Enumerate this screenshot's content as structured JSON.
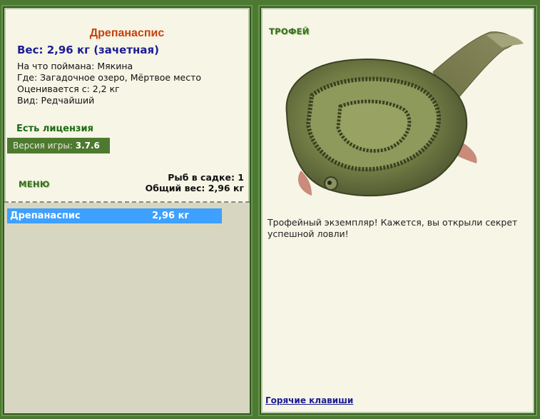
{
  "fish": {
    "name": "Дрепанаспис",
    "weight_line": "Вес: 2,96 кг (зачетная)",
    "info": [
      "На что поймана: Мякина",
      "Где: Загадочное озеро, Мёртвое место",
      "Оценивается с: 2,2 кг",
      "Вид: Редчайший"
    ]
  },
  "license": "Есть лицензия",
  "version": {
    "label": "Версия игры: ",
    "value": "3.7.6"
  },
  "menu_label": "МЕНЮ",
  "stats": {
    "fish_count": "Рыб в садке: 1",
    "total_weight": "Общий вес: 2,96 кг"
  },
  "catch_list": [
    {
      "name": "Дрепанаспис",
      "weight": "2,96 кг"
    }
  ],
  "trophy": {
    "label": "ТРОФЕЙ",
    "text": "Трофейный экземпляр! Кажется, вы открыли секрет успешной ловли!"
  },
  "hotkeys": "Горячие клавиши",
  "colors": {
    "frame": "#4d7a32",
    "panel_bg": "#f6f5e6",
    "fish_name": "#c8400d",
    "weight": "#1b1d92",
    "selected_row": "#3ea0ff"
  }
}
